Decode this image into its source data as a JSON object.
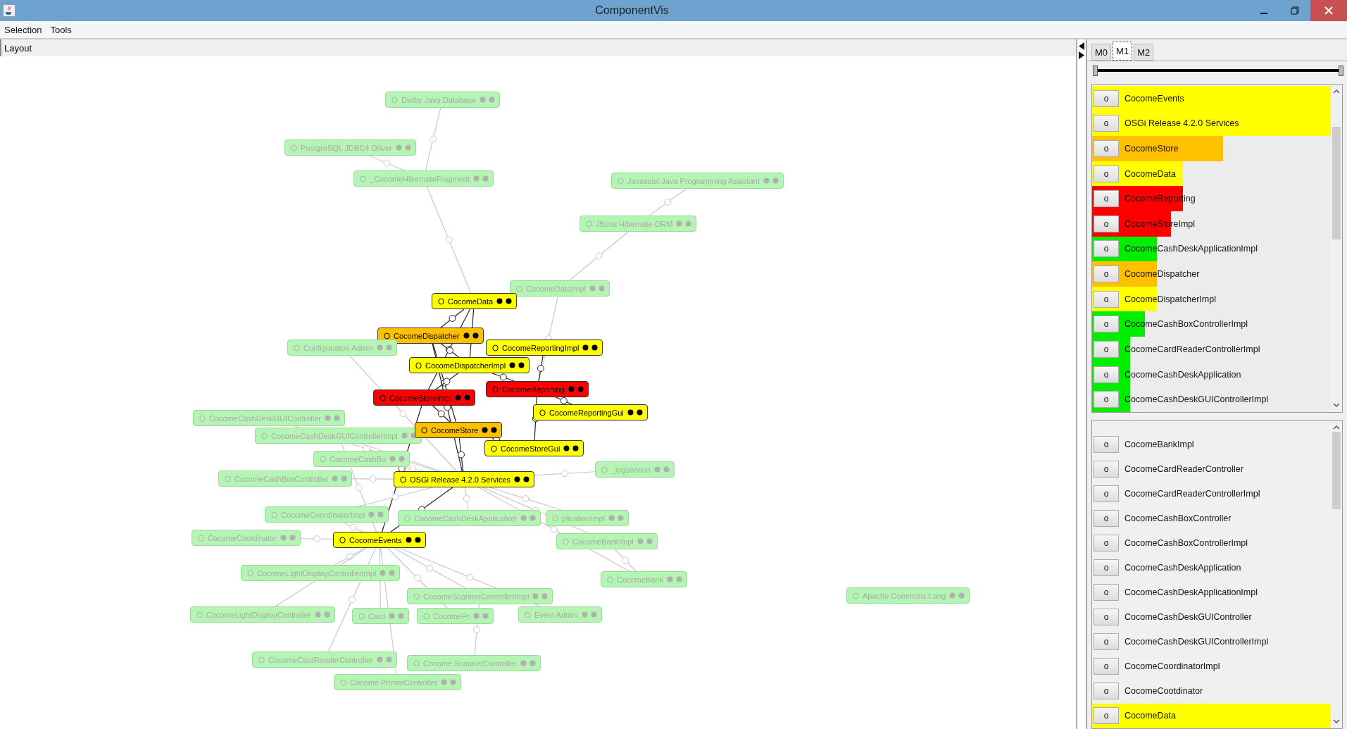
{
  "window": {
    "title": "ComponentVis"
  },
  "menu": [
    "Selection",
    "Tools"
  ],
  "layout_header": "Layout",
  "graph": {
    "nodes": [
      {
        "label": "Derby Java Database",
        "kind": "faded",
        "color": "#b4f5b4"
      },
      {
        "label": "PostgreSQL JDBC4 Driver",
        "kind": "faded",
        "color": "#b4f5b4"
      },
      {
        "label": "_CocomeHibernateFragment",
        "kind": "faded",
        "color": "#b4f5b4"
      },
      {
        "label": "Javassist Java Programming Assistant",
        "kind": "faded",
        "color": "#b4f5b4"
      },
      {
        "label": "JBoss Hibernate ORM",
        "kind": "faded",
        "color": "#b4f5b4"
      },
      {
        "label": "CocomeDataImpl",
        "kind": "faded",
        "color": "#b4f5b4"
      },
      {
        "label": "CocomeData",
        "kind": "highlighted",
        "color": "#ffff00"
      },
      {
        "label": "CocomeDispatcher",
        "kind": "highlighted",
        "color": "#ffc000"
      },
      {
        "label": "Configuration Admin",
        "kind": "faded",
        "color": "#b4f5b4"
      },
      {
        "label": "CocomeReportingImpl",
        "kind": "highlighted",
        "color": "#ffff00"
      },
      {
        "label": "CocomeDispatcherImpl",
        "kind": "highlighted",
        "color": "#ffff00"
      },
      {
        "label": "CocomeStoreImpl",
        "kind": "highlighted",
        "color": "#ff0000"
      },
      {
        "label": "CocomeReporting",
        "kind": "highlighted",
        "color": "#ff0000"
      },
      {
        "label": "CocomeCashDeskGUIController",
        "kind": "faded",
        "color": "#b4f5b4"
      },
      {
        "label": "CocomeReportingGui",
        "kind": "highlighted",
        "color": "#ffff00"
      },
      {
        "label": "CocomeCashDeskGUIControllerImpl",
        "kind": "faded",
        "color": "#b4f5b4"
      },
      {
        "label": "CocomeStore",
        "kind": "highlighted",
        "color": "#ffc000"
      },
      {
        "label": "CocomeStoreGui",
        "kind": "highlighted",
        "color": "#ffff00"
      },
      {
        "label": "CocomeCashBo",
        "kind": "faded",
        "color": "#b4f5b4"
      },
      {
        "label": "_logservice",
        "kind": "faded",
        "color": "#b4f5b4"
      },
      {
        "label": "CocomeCashBoxController",
        "kind": "faded",
        "color": "#b4f5b4"
      },
      {
        "label": "OSGi Release 4.2.0 Services",
        "kind": "highlighted",
        "color": "#ffff00"
      },
      {
        "label": "CocomeCoordinatorImpl",
        "kind": "faded",
        "color": "#b4f5b4"
      },
      {
        "label": "CocomeCashDeskApplication",
        "kind": "faded",
        "color": "#b4f5b4"
      },
      {
        "label": "plicationImpl",
        "kind": "faded",
        "color": "#b4f5b4"
      },
      {
        "label": "CocomeCootdinator",
        "kind": "faded",
        "color": "#b4f5b4"
      },
      {
        "label": "CocomeEvents",
        "kind": "highlighted",
        "color": "#ffff00"
      },
      {
        "label": "CocomeBankImpl",
        "kind": "faded",
        "color": "#b4f5b4"
      },
      {
        "label": "CocomeLightDisplayControllerImpl",
        "kind": "faded",
        "color": "#b4f5b4"
      },
      {
        "label": "CocomeBank",
        "kind": "faded",
        "color": "#b4f5b4"
      },
      {
        "label": "CocomeScannerControllerImpl",
        "kind": "faded",
        "color": "#b4f5b4"
      },
      {
        "label": "Apache Commons Lang",
        "kind": "faded",
        "color": "#b4f5b4"
      },
      {
        "label": "CocomeLightDisplayController",
        "kind": "faded",
        "color": "#b4f5b4"
      },
      {
        "label": "Card",
        "kind": "faded",
        "color": "#b4f5b4"
      },
      {
        "label": "CocomePr",
        "kind": "faded",
        "color": "#b4f5b4"
      },
      {
        "label": "Event Admin",
        "kind": "faded",
        "color": "#b4f5b4"
      },
      {
        "label": "CocomeCardReaderController",
        "kind": "faded",
        "color": "#b4f5b4"
      },
      {
        "label": "Cocome.ScannerController",
        "kind": "faded",
        "color": "#b4f5b4"
      },
      {
        "label": "Cocome.PrinterController",
        "kind": "faded",
        "color": "#b4f5b4"
      }
    ]
  },
  "side_panel": {
    "tabs": [
      {
        "label": "M0",
        "selected": false
      },
      {
        "label": "M1",
        "selected": true
      },
      {
        "label": "M2",
        "selected": false
      }
    ],
    "slider": {
      "level": 1
    },
    "upper_list": [
      {
        "button": "o",
        "label": "CocomeEvents",
        "level": 1,
        "color": "#ffff00"
      },
      {
        "button": "o",
        "label": "OSGi Release 4.2.0 Services",
        "level": 1,
        "color": "#ffff00"
      },
      {
        "button": "o",
        "label": "CocomeStore",
        "level": 0.55,
        "color": "#ffc000"
      },
      {
        "button": "o",
        "label": "CocomeData",
        "level": 0.38,
        "color": "#ffff00"
      },
      {
        "button": "o",
        "label": "CocomeReporting",
        "level": 0.38,
        "color": "#ff0000"
      },
      {
        "button": "o",
        "label": "CocomeStoreImpl",
        "level": 0.33,
        "color": "#ff0000"
      },
      {
        "button": "o",
        "label": "CocomeCashDeskApplicationImpl",
        "level": 0.27,
        "color": "#00ee00"
      },
      {
        "button": "o",
        "label": "CocomeDispatcher",
        "level": 0.27,
        "color": "#ffc000"
      },
      {
        "button": "o",
        "label": "CocomeDispatcherImpl",
        "level": 0.27,
        "color": "#ffff00"
      },
      {
        "button": "o",
        "label": "CocomeCashBoxControllerImpl",
        "level": 0.22,
        "color": "#00ee00"
      },
      {
        "button": "o",
        "label": "CocomeCardReaderControllerImpl",
        "level": 0.16,
        "color": "#00ee00"
      },
      {
        "button": "o",
        "label": "CocomeCashDeskApplication",
        "level": 0.16,
        "color": "#00ee00"
      },
      {
        "button": "o",
        "label": "CocomeCashDeskGUIControllerImpl",
        "level": 0.16,
        "color": "#00ee00"
      }
    ],
    "lower_list": [
      {
        "button": "o",
        "label": "CocomeBankImpl"
      },
      {
        "button": "o",
        "label": "CocomeCardReaderController"
      },
      {
        "button": "o",
        "label": "CocomeCardReaderControllerImpl"
      },
      {
        "button": "o",
        "label": "CocomeCashBoxController"
      },
      {
        "button": "o",
        "label": "CocomeCashBoxControllerImpl"
      },
      {
        "button": "o",
        "label": "CocomeCashDeskApplication"
      },
      {
        "button": "o",
        "label": "CocomeCashDeskApplicationImpl"
      },
      {
        "button": "o",
        "label": "CocomeCashDeskGUIController"
      },
      {
        "button": "o",
        "label": "CocomeCashDeskGUIControllerImpl"
      },
      {
        "button": "o",
        "label": "CocomeCoordinatorImpl"
      },
      {
        "button": "o",
        "label": "CocomeCootdinator"
      },
      {
        "button": "o",
        "label": "CocomeData",
        "level": 1,
        "color": "#ffff00"
      }
    ]
  }
}
